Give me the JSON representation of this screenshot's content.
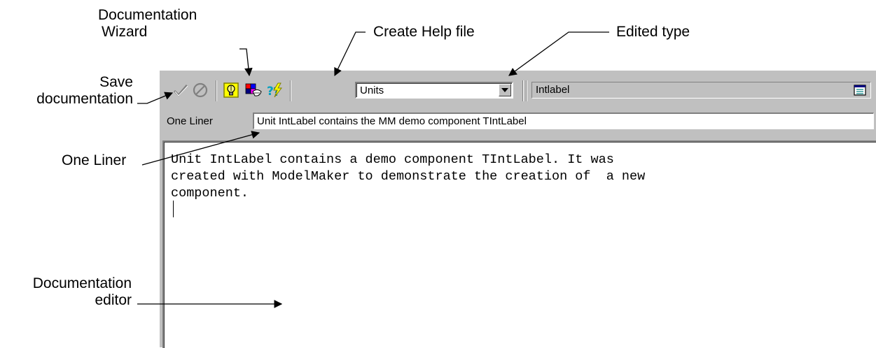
{
  "callouts": {
    "doc_wizard_line1": "Documentation",
    "doc_wizard_line2": "Wizard",
    "create_help": "Create Help file",
    "edited_type": "Edited type",
    "save_line1": "Save",
    "save_line2": "documentation",
    "one_liner": "One Liner",
    "doc_editor_line1": "Documentation",
    "doc_editor_line2": "editor"
  },
  "toolbar": {
    "icons": [
      "checkmark-icon",
      "cancel-icon",
      "lightbulb-wizard-icon",
      "palette-icon",
      "help-lightning-icon",
      "grid-icon"
    ],
    "type_combo_value": "Units",
    "edited_name_value": "Intlabel"
  },
  "one_liner": {
    "label": "One Liner",
    "value": "Unit IntLabel contains the MM demo component TIntLabel"
  },
  "editor": {
    "text": "Unit IntLabel contains a demo component TIntLabel. It was\ncreated with ModelMaker to demonstrate the creation of  a new\ncomponent."
  }
}
